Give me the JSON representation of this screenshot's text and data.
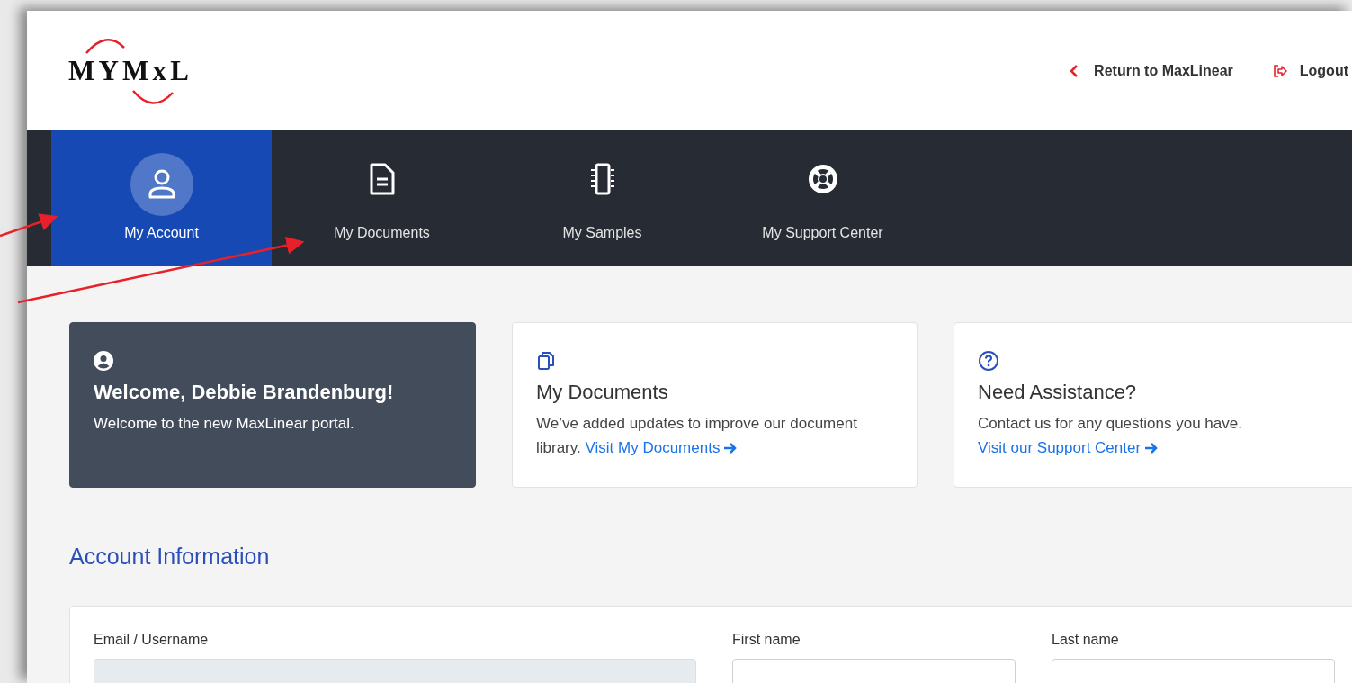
{
  "header": {
    "logo": "MYMxL",
    "links": [
      {
        "kind": "back",
        "label": "Return to MaxLinear"
      },
      {
        "kind": "logout",
        "label": "Logout"
      }
    ]
  },
  "nav": {
    "items": [
      {
        "label": "My Account",
        "selected": true
      },
      {
        "label": "My Documents",
        "selected": false
      },
      {
        "label": "My Samples",
        "selected": false
      },
      {
        "label": "My Support Center",
        "selected": false
      }
    ]
  },
  "cards": [
    {
      "kind": "welcome",
      "title": "Welcome, Debbie Brandenburg!",
      "text": "Welcome to the new MaxLinear portal."
    },
    {
      "kind": "info",
      "title": "My Documents",
      "text": "We’ve added updates to improve our document library.",
      "link": "Visit My Documents"
    },
    {
      "kind": "info",
      "title": "Need Assistance?",
      "text": "Contact us for any questions you have.",
      "link": "Visit our Support Center"
    }
  ],
  "account": {
    "title": "Account Information",
    "fields": [
      {
        "label": "Email / Username",
        "disabled": true
      },
      {
        "label": "First name",
        "disabled": false
      },
      {
        "label": "Last name",
        "disabled": false
      }
    ]
  }
}
